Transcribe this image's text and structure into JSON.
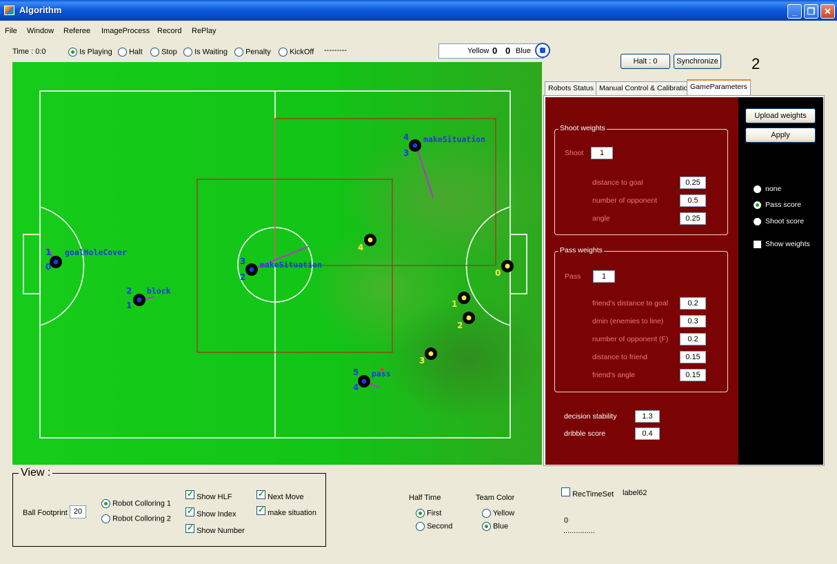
{
  "window": {
    "title": "Algorithm",
    "btn_min": "_",
    "btn_max": "❐",
    "btn_close": "✕"
  },
  "menu": [
    "File",
    "Window",
    "Referee",
    "ImageProcess",
    "Record",
    "RePlay"
  ],
  "status": {
    "time": "Time : 0:0",
    "modes": [
      {
        "label": "Is Playing",
        "selected": true
      },
      {
        "label": "Halt",
        "selected": false
      },
      {
        "label": "Stop",
        "selected": false
      },
      {
        "label": "Is Waiting",
        "selected": false
      },
      {
        "label": "Penalty",
        "selected": false
      },
      {
        "label": "KickOff",
        "selected": false
      }
    ],
    "dots": "---------"
  },
  "score": {
    "yellow_label": "Yellow",
    "yellow_score": "0",
    "blue_score": "0",
    "blue_label": "Blue"
  },
  "controls": {
    "halt": "Halt : 0",
    "synchronize": "Synchronize",
    "big_number": "2"
  },
  "field": {
    "blue_robots": [
      {
        "top_num": "1",
        "bottom_num": "0",
        "label": "goalHoleCover"
      },
      {
        "top_num": "2",
        "bottom_num": "1",
        "label": "block"
      },
      {
        "top_num": "3",
        "bottom_num": "2",
        "label": "makeSituation"
      },
      {
        "top_num": "4",
        "bottom_num": "3",
        "label": "makeSituation"
      },
      {
        "top_num": "5",
        "bottom_num": "4",
        "label": "pass"
      }
    ],
    "yellow_robots": [
      "4",
      "0",
      "1",
      "2",
      "3"
    ]
  },
  "tabs": [
    {
      "label": "Robots Status",
      "active": false
    },
    {
      "label": "Manual Control & Calibration",
      "active": false
    },
    {
      "label": "GameParameters",
      "active": true
    }
  ],
  "shoot_weights": {
    "title": "Shoot weights",
    "shoot_label": "Shoot",
    "shoot_value": "1",
    "rows": [
      {
        "label": "distance to goal",
        "value": "0.25"
      },
      {
        "label": "number of opponent",
        "value": "0.5"
      },
      {
        "label": "angle",
        "value": "0.25"
      }
    ]
  },
  "pass_weights": {
    "title": "Pass weights",
    "pass_label": "Pass",
    "pass_value": "1",
    "rows": [
      {
        "label": "friend's distance to goal",
        "value": "0.2"
      },
      {
        "label": "dmin (enemies to line)",
        "value": "0.3"
      },
      {
        "label": "number of opponent (F)",
        "value": "0.2"
      },
      {
        "label": "distance to friend",
        "value": "0.15"
      },
      {
        "label": "friend's angle",
        "value": "0.15"
      }
    ]
  },
  "extra": {
    "decision_label": "decision stability",
    "decision_value": "1.3",
    "dribble_label": "dribble score",
    "dribble_value": "0.4"
  },
  "side": {
    "upload": "Upload weights",
    "apply": "Apply",
    "radios": [
      {
        "label": "none",
        "selected": false
      },
      {
        "label": "Pass score",
        "selected": true
      },
      {
        "label": "Shoot score",
        "selected": false
      }
    ],
    "show_weights": "Show weights"
  },
  "view": {
    "title": "View :",
    "ball_footprint_label": "Ball Footprint :",
    "ball_footprint_value": "20",
    "coloring": [
      {
        "label": "Robot Colloring 1",
        "selected": true
      },
      {
        "label": "Robot Colloring 2",
        "selected": false
      }
    ],
    "checks": [
      {
        "label": "Show HLF",
        "checked": true
      },
      {
        "label": "Show Index",
        "checked": true
      },
      {
        "label": "Show Number",
        "checked": true
      },
      {
        "label": "Next Move",
        "checked": true
      },
      {
        "label": "make situation",
        "checked": true
      }
    ]
  },
  "half_time": {
    "title": "Half Time",
    "first": "First",
    "second": "Second"
  },
  "team_color": {
    "title": "Team Color",
    "yellow": "Yellow",
    "blue": "Blue"
  },
  "rec": {
    "label": "RecTimeSet",
    "label62": "label62",
    "zero": "0",
    "dots": "..............."
  },
  "colors": {
    "field": "#12c416",
    "panel_red": "#7a0404",
    "blue_robot": "#1f39e0",
    "yellow_robot": "#ffe94a"
  }
}
